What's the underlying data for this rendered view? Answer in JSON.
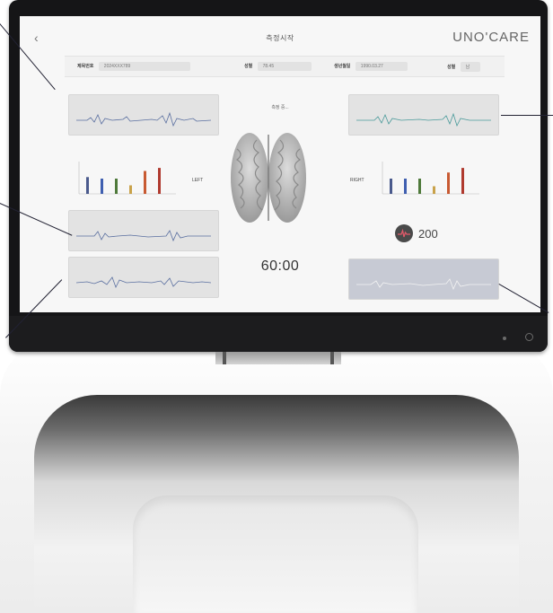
{
  "screen": {
    "title": "측정시작",
    "back_icon": "chevron-left-icon",
    "logo": "UNO'CARE"
  },
  "info_bar": {
    "fields": [
      {
        "label": "제목번호",
        "value": "2024XXX789"
      },
      {
        "label": "성별",
        "value": "78.45"
      },
      {
        "label": "생년월일",
        "value": "1990.03.27"
      },
      {
        "label": "성별",
        "value": "남"
      }
    ]
  },
  "status": "측정 중...",
  "timer": "60:00",
  "heart_rate": {
    "value": "200",
    "icon": "heart-pulse-icon"
  },
  "left": {
    "label": "LEFT",
    "bars": [
      {
        "value": 0.55,
        "color": "#4a5a8c"
      },
      {
        "value": 0.5,
        "color": "#3f5fb0"
      },
      {
        "value": 0.5,
        "color": "#4f7a3b"
      },
      {
        "value": 0.28,
        "color": "#c9a24a"
      },
      {
        "value": 0.75,
        "color": "#c85a32"
      },
      {
        "value": 0.85,
        "color": "#b03a2f"
      }
    ]
  },
  "right": {
    "label": "RIGHT",
    "bars": [
      {
        "value": 0.5,
        "color": "#4a5a8c"
      },
      {
        "value": 0.5,
        "color": "#3f5fb0"
      },
      {
        "value": 0.5,
        "color": "#4f7a3b"
      },
      {
        "value": 0.25,
        "color": "#c9a24a"
      },
      {
        "value": 0.7,
        "color": "#c85a32"
      },
      {
        "value": 0.85,
        "color": "#b03a2f"
      }
    ]
  },
  "colors": {
    "wave_blue": "#5a6fa0",
    "wave_teal": "#4a9a9a",
    "wave_white": "#f2f2f2"
  }
}
